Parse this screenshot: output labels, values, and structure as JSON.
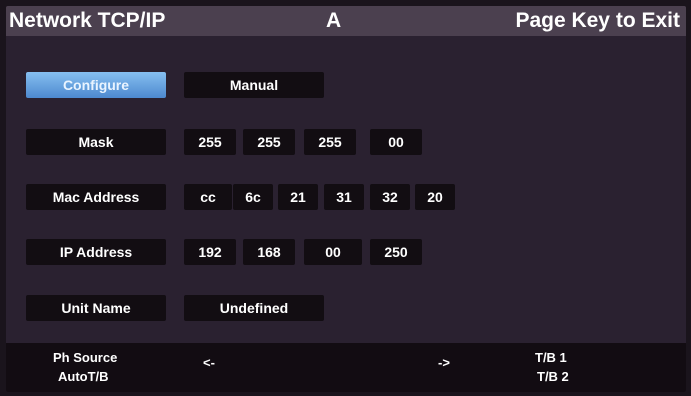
{
  "header": {
    "title": "Network TCP/IP",
    "mode": "A",
    "hint": "Page Key to Exit"
  },
  "rows": {
    "configure": {
      "label": "Configure",
      "value": "Manual"
    },
    "mask": {
      "label": "Mask",
      "octets": [
        "255",
        "255",
        "255",
        "00"
      ]
    },
    "mac": {
      "label": "Mac Address",
      "bytes": [
        "cc",
        "6c",
        "21",
        "31",
        "32",
        "20"
      ]
    },
    "ip": {
      "label": "IP Address",
      "octets": [
        "192",
        "168",
        "00",
        "250"
      ]
    },
    "unit": {
      "label": "Unit Name",
      "value": "Undefined"
    }
  },
  "footer": {
    "ph_source": "Ph Source",
    "auto_tb": "AutoT/B",
    "prev": "<-",
    "next": "->",
    "tb1": "T/B 1",
    "tb2": "T/B 2"
  },
  "colors": {
    "selected_start": "#86bff0",
    "selected_end": "#4d89cf",
    "field_bg": "#120d12",
    "panel_bg": "#2a2130",
    "title_bg": "#4b404f"
  }
}
